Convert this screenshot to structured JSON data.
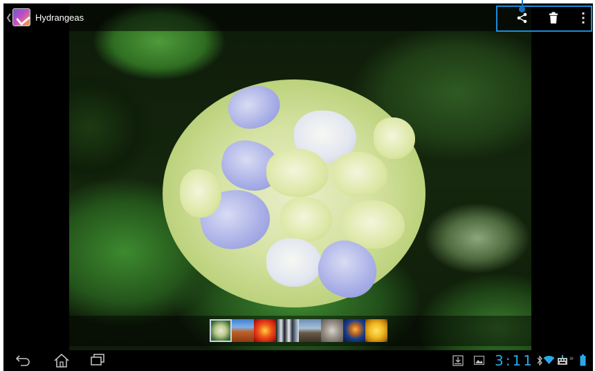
{
  "actionbar": {
    "title": "Hydrangeas",
    "back_icon": "chevron-left-icon",
    "app_icon": "gallery-app-icon",
    "actions": [
      {
        "name": "share",
        "icon": "share-icon"
      },
      {
        "name": "delete",
        "icon": "trash-icon"
      },
      {
        "name": "more",
        "icon": "overflow-menu-icon"
      }
    ],
    "highlight_color": "#1b8ddb"
  },
  "filmstrip": {
    "thumbnails": [
      {
        "subject": "Hydrangeas",
        "selected": true
      },
      {
        "subject": "Desert"
      },
      {
        "subject": "Chrysanthemum"
      },
      {
        "subject": "Penguins"
      },
      {
        "subject": "Lighthouse"
      },
      {
        "subject": "Koala"
      },
      {
        "subject": "Jellyfish"
      },
      {
        "subject": "Tulips"
      }
    ]
  },
  "navbar": {
    "buttons": [
      "back-icon",
      "home-icon",
      "recent-apps-icon"
    ],
    "status": {
      "clock": "3:11",
      "icons": [
        "download-icon",
        "gallery-notification-icon",
        "bluetooth-icon",
        "wifi-icon",
        "keyboard-icon",
        "more-icon",
        "battery-icon"
      ],
      "clock_color": "#2aa8e6"
    }
  }
}
